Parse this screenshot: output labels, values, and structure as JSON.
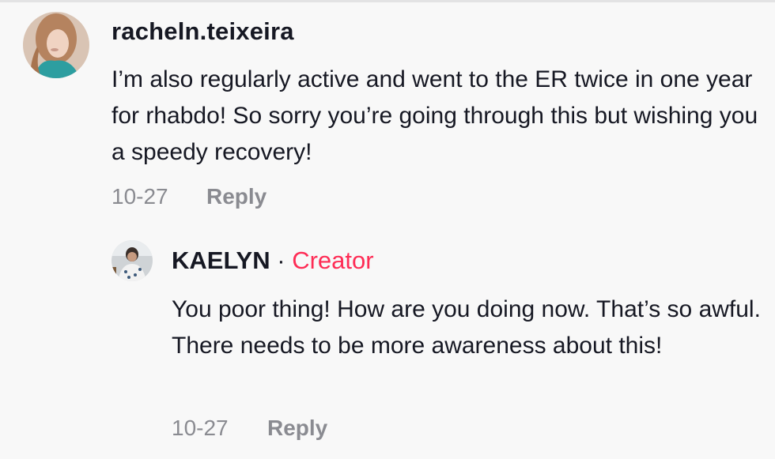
{
  "comments": [
    {
      "username": "racheln.teixeira",
      "text": "I’m also regularly active and went to the ER twice in one year for rhabdo! So sorry you’re going through this but wishing you a speedy recovery!",
      "date": "10-27",
      "reply_label": "Reply",
      "avatar_icon": "user-avatar-photo"
    },
    {
      "username": "KAELYN",
      "separator": "·",
      "badge": "Creator",
      "text": "You poor thing! How are you doing now. That’s so awful. There needs to be more awareness about this!",
      "date": "10-27",
      "reply_label": "Reply",
      "avatar_icon": "user-avatar-photo"
    }
  ],
  "colors": {
    "background": "#f8f8f8",
    "text": "#161823",
    "muted": "#8a8b91",
    "creator_accent": "#fe2c55"
  }
}
